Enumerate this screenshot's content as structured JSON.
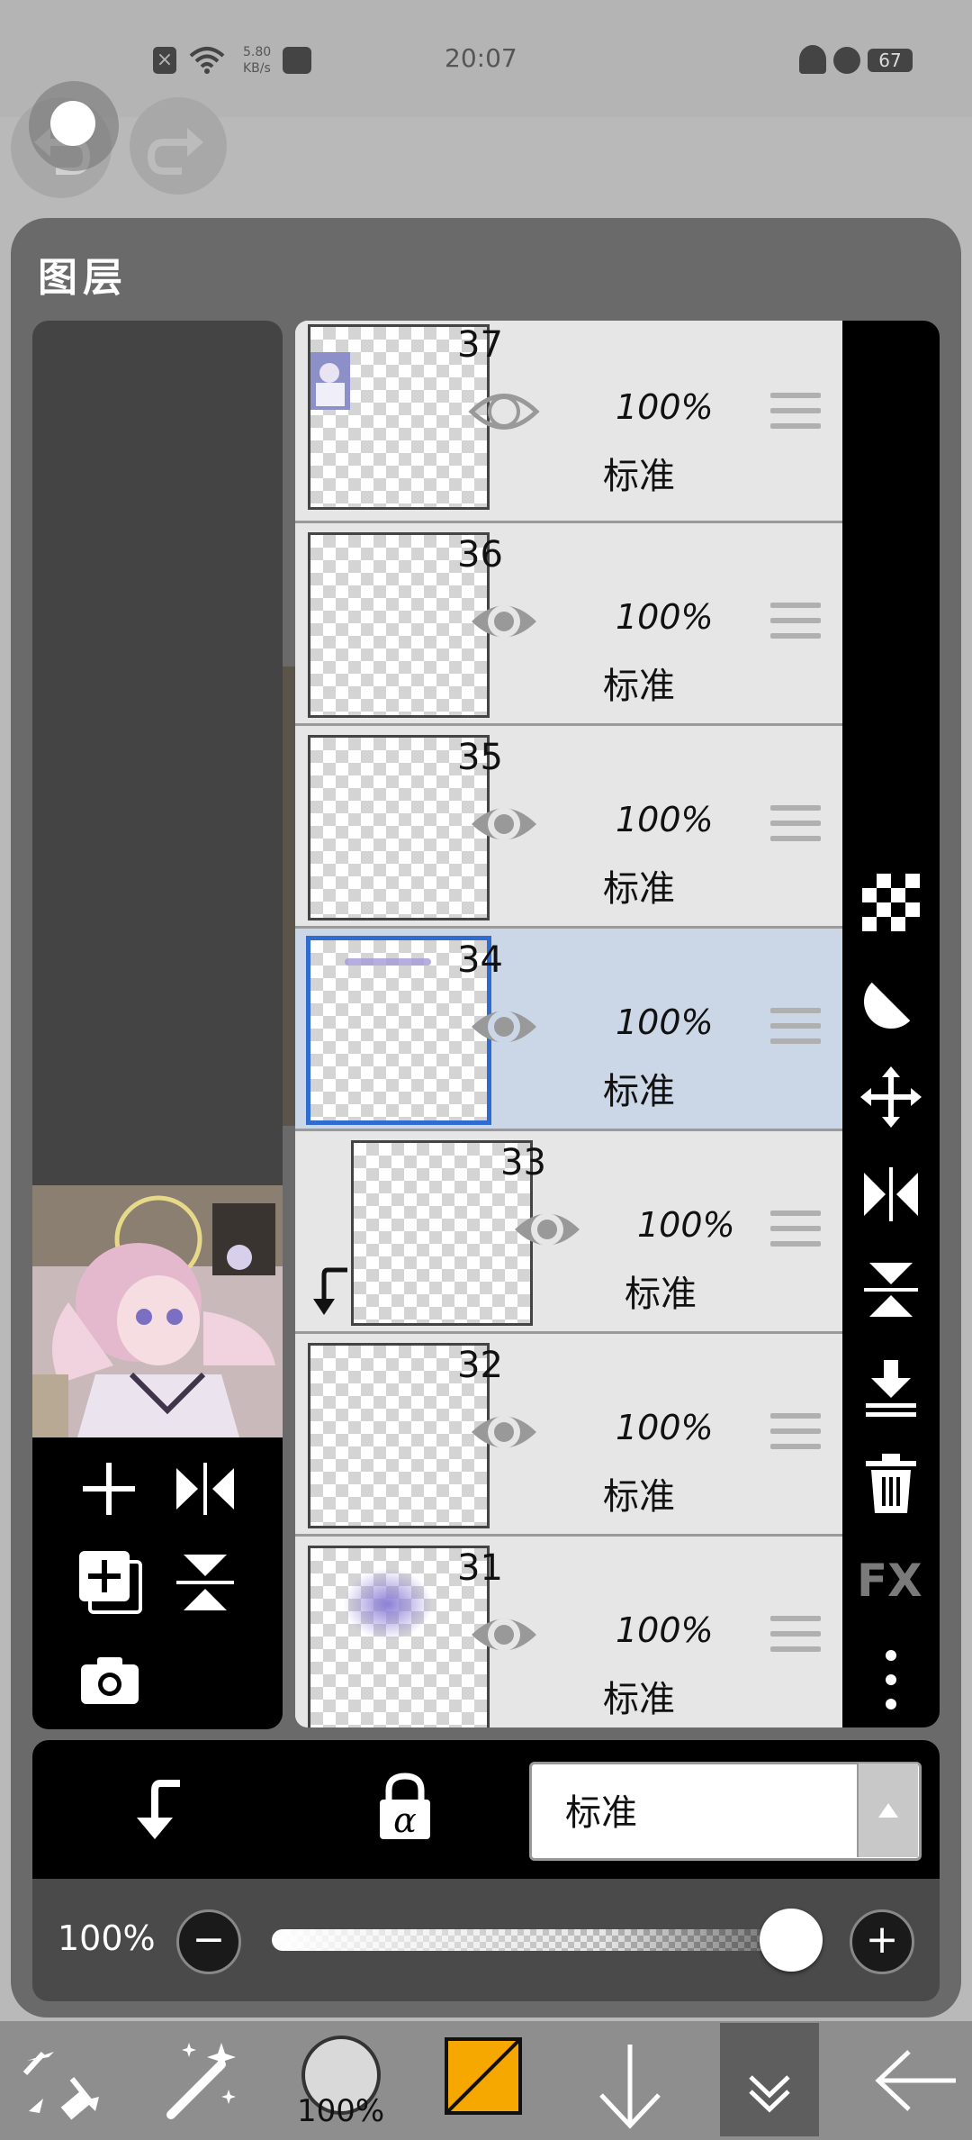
{
  "status_bar": {
    "net_speed_value": "5.80",
    "net_speed_unit": "KB/s",
    "time": "20:07",
    "battery": "67"
  },
  "panel": {
    "title": "图层"
  },
  "layers": [
    {
      "number": "37",
      "opacity": "100%",
      "mode": "标准",
      "selected": false,
      "clipped": false
    },
    {
      "number": "36",
      "opacity": "100%",
      "mode": "标准",
      "selected": false,
      "clipped": false
    },
    {
      "number": "35",
      "opacity": "100%",
      "mode": "标准",
      "selected": false,
      "clipped": false
    },
    {
      "number": "34",
      "opacity": "100%",
      "mode": "标准",
      "selected": true,
      "clipped": false
    },
    {
      "number": "33",
      "opacity": "100%",
      "mode": "标准",
      "selected": false,
      "clipped": true
    },
    {
      "number": "32",
      "opacity": "100%",
      "mode": "标准",
      "selected": false,
      "clipped": false
    },
    {
      "number": "31",
      "opacity": "100%",
      "mode": "标准",
      "selected": false,
      "clipped": false
    }
  ],
  "right_tools": {
    "fx_label": "FX"
  },
  "blend": {
    "mode_label": "标准"
  },
  "opacity": {
    "label": "100%",
    "value": 1.0
  },
  "toolbar": {
    "brush_size_label": "100%",
    "current_color": "#f7a800"
  },
  "colors": {
    "selection_border": "#2f6bd0",
    "selected_row": "#cbd7e7"
  }
}
